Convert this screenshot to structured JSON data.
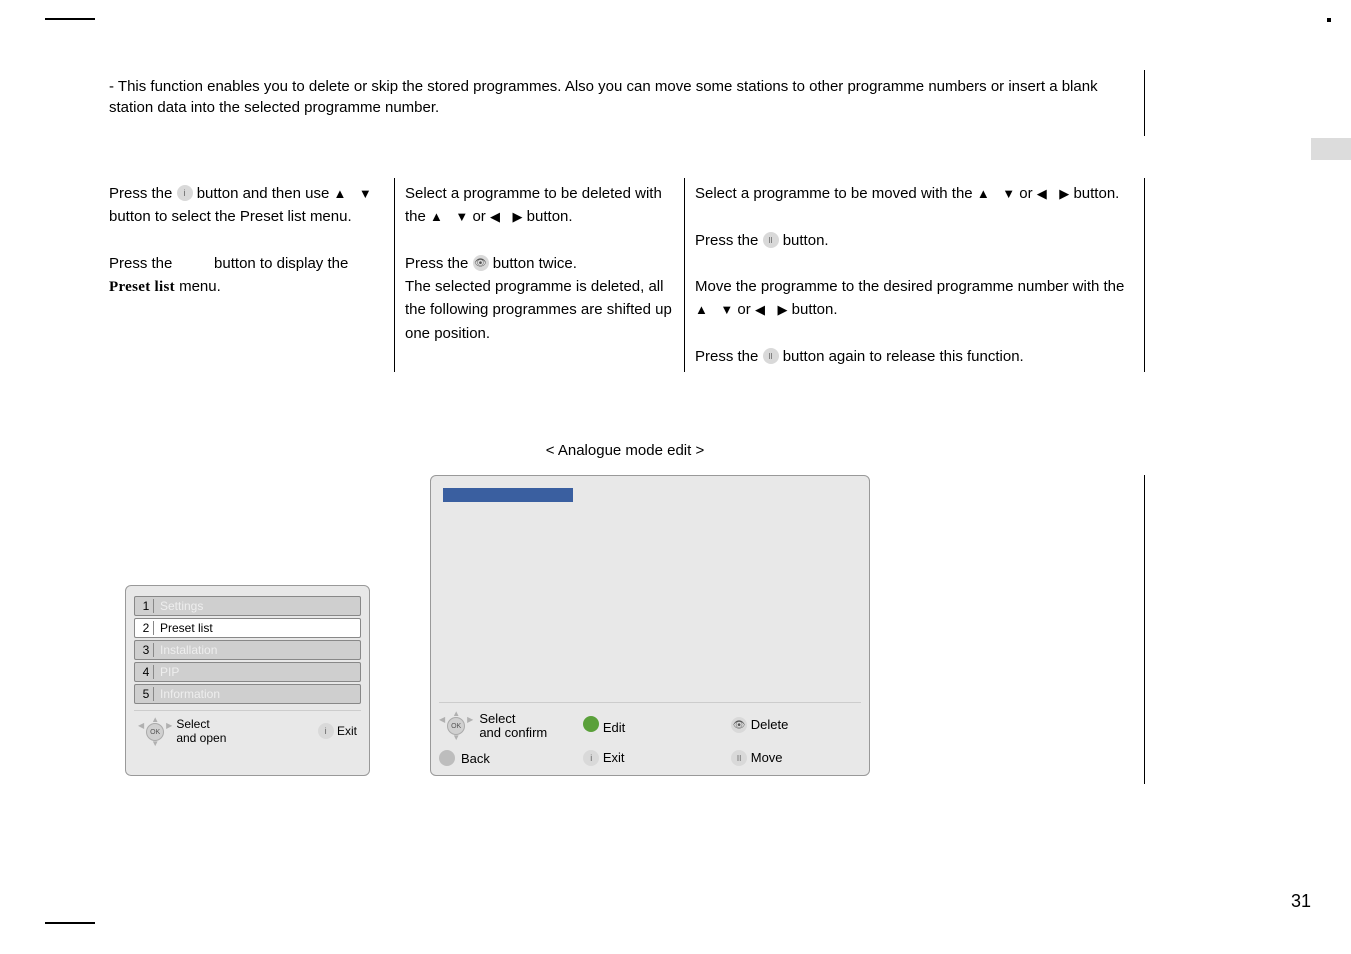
{
  "intro": "This function enables you to delete or skip the stored programmes. Also you can move some stations to other programme numbers or insert a blank station data into the selected programme number.",
  "col1": {
    "l1a": "Press the ",
    "l1b": " button and then use ",
    "l2": " button to select the Preset list menu.",
    "l3a": "Press the ",
    "l3b": " button to display the ",
    "l3c": "Preset list",
    "l3d": " menu."
  },
  "col2": {
    "p1a": "Select a programme to be deleted with the ",
    "p1b": " button.",
    "p2a": "Press the ",
    "p2b": " button twice.",
    "p3": "The selected programme is deleted, all the following programmes are shifted up one position."
  },
  "col3": {
    "p1a": "Select a programme to be moved with the ",
    "p1b": " button.",
    "p2a": "Press the ",
    "p2b": " button.",
    "p3a": "Move the programme to the desired programme number with the ",
    "p3b": " button.",
    "p4a": "Press the ",
    "p4b": " button again to release this function."
  },
  "amodeHeading": "< Analogue mode edit >",
  "menuPanel": {
    "items": [
      {
        "num": "1",
        "label": "Settings",
        "active": false
      },
      {
        "num": "2",
        "label": "Preset list",
        "active": true
      },
      {
        "num": "3",
        "label": "Installation",
        "active": false
      },
      {
        "num": "4",
        "label": "PIP",
        "active": false
      },
      {
        "num": "5",
        "label": "Information",
        "active": false
      }
    ],
    "footerLeft": "Select and open",
    "footerRight": "Exit"
  },
  "editPanel": {
    "footer": {
      "selectConfirm": "Select and confirm",
      "edit": "Edit",
      "delete": "Delete",
      "back": "Back",
      "exit": "Exit",
      "move": "Move"
    }
  },
  "pageNumber": "31",
  "glyphs": {
    "up": "▲",
    "down": "▼",
    "left": "◀",
    "right": "▶"
  }
}
